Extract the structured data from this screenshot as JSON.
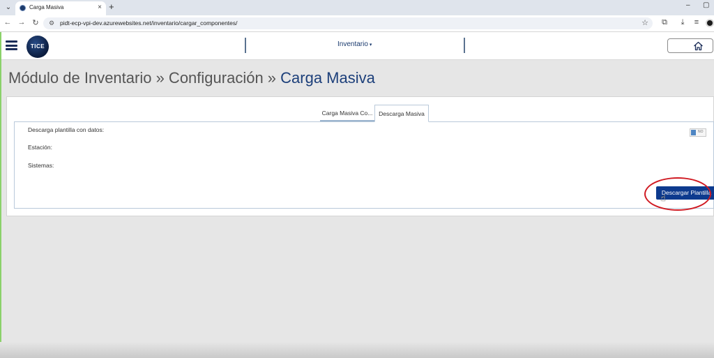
{
  "browser": {
    "tab_title": "Carga Masiva",
    "tab_close": "×",
    "new_tab": "+",
    "url": "pidt-ecp-vpi-dev.azurewebsites.net/inventario/cargar_componentes/",
    "minimize": "–",
    "restore": "▢"
  },
  "header": {
    "logo_text": "TICE",
    "nav_menu_label": "Inventario",
    "nav_caret": "▾"
  },
  "page": {
    "breadcrumb_part1": "Módulo de Inventario » Configuración » ",
    "breadcrumb_current": "Carga Masiva"
  },
  "tabs": [
    {
      "label": "Carga Masiva Co...",
      "active": false
    },
    {
      "label": "Descarga Masiva",
      "active": true
    }
  ],
  "form": {
    "label_download_with_data": "Descarga plantilla con datos:",
    "label_station": "Estación:",
    "label_systems": "Sistemas:",
    "toggle_text": "NO",
    "toggle_on": false,
    "download_button": "Descargar Plantilla"
  },
  "colors": {
    "brand_navy": "#0d3a8e",
    "title_blue": "#1c3f7a",
    "highlight_red": "#d01a22"
  }
}
